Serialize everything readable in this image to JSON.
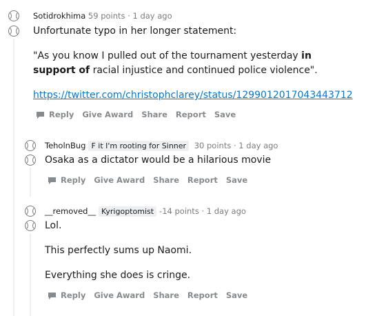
{
  "comments": [
    {
      "author": "Sotidrokhima",
      "flair": "",
      "points": "59 points",
      "separator": "·",
      "time": "1 day ago",
      "paragraphs": [
        "Unfortunate typo in her longer statement:"
      ],
      "quote_before": "\"As you know I pulled out of the tournament yesterday ",
      "quote_bold": "in support of",
      "quote_after": " racial injustice and continued police violence\".",
      "link": "https://twitter.com/christophclarey/status/1299012017043443712",
      "actions": [
        "Reply",
        "Give Award",
        "Share",
        "Report",
        "Save"
      ]
    },
    {
      "author": "TeholnBug",
      "flair": "F it I'm rooting for Sinner",
      "points": "30 points",
      "separator": "·",
      "time": "1 day ago",
      "paragraphs": [
        "Osaka as a dictator would be a hilarious movie"
      ],
      "actions": [
        "Reply",
        "Give Award",
        "Share",
        "Report",
        "Save"
      ]
    },
    {
      "author": "__removed__",
      "flair": "Kyrigoptomist",
      "points": "-14 points",
      "separator": "·",
      "time": "1 day ago",
      "paragraphs": [
        "Lol.",
        "This perfectly sums up Naomi.",
        "Everything she does is cringe."
      ],
      "actions": [
        "Reply",
        "Give Award",
        "Share",
        "Report",
        "Save"
      ]
    }
  ],
  "icons": {
    "avatar": "tennis-ball-icon",
    "reply": "speech-bubble-icon"
  },
  "colors": {
    "link": "#0079d3",
    "meta": "#7c7c7c",
    "action": "#878a8c",
    "thread_line": "#edeff1",
    "flair_bg": "#edeff1"
  }
}
